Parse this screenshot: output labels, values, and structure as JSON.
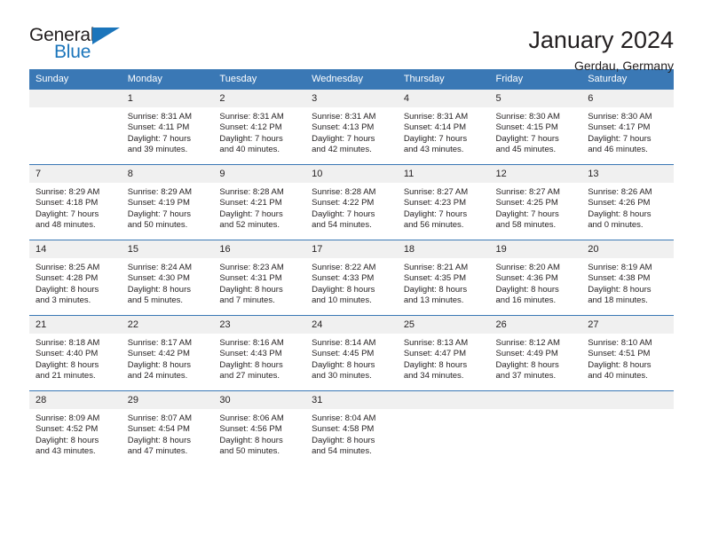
{
  "logo": {
    "word_one": "General",
    "word_two": "Blue",
    "accent_color": "#1b75bb",
    "triangle_icon": "triangle-icon"
  },
  "header": {
    "title": "January 2024",
    "subtitle": "Gerdau, Germany"
  },
  "calendar": {
    "header_bg": "#3a78b5",
    "daynum_bg": "#f0f0f0",
    "weekdays": [
      "Sunday",
      "Monday",
      "Tuesday",
      "Wednesday",
      "Thursday",
      "Friday",
      "Saturday"
    ],
    "weeks": [
      [
        {
          "day": "",
          "sunrise": "",
          "sunset": "",
          "daylight1": "",
          "daylight2": ""
        },
        {
          "day": "1",
          "sunrise": "Sunrise: 8:31 AM",
          "sunset": "Sunset: 4:11 PM",
          "daylight1": "Daylight: 7 hours",
          "daylight2": "and 39 minutes."
        },
        {
          "day": "2",
          "sunrise": "Sunrise: 8:31 AM",
          "sunset": "Sunset: 4:12 PM",
          "daylight1": "Daylight: 7 hours",
          "daylight2": "and 40 minutes."
        },
        {
          "day": "3",
          "sunrise": "Sunrise: 8:31 AM",
          "sunset": "Sunset: 4:13 PM",
          "daylight1": "Daylight: 7 hours",
          "daylight2": "and 42 minutes."
        },
        {
          "day": "4",
          "sunrise": "Sunrise: 8:31 AM",
          "sunset": "Sunset: 4:14 PM",
          "daylight1": "Daylight: 7 hours",
          "daylight2": "and 43 minutes."
        },
        {
          "day": "5",
          "sunrise": "Sunrise: 8:30 AM",
          "sunset": "Sunset: 4:15 PM",
          "daylight1": "Daylight: 7 hours",
          "daylight2": "and 45 minutes."
        },
        {
          "day": "6",
          "sunrise": "Sunrise: 8:30 AM",
          "sunset": "Sunset: 4:17 PM",
          "daylight1": "Daylight: 7 hours",
          "daylight2": "and 46 minutes."
        }
      ],
      [
        {
          "day": "7",
          "sunrise": "Sunrise: 8:29 AM",
          "sunset": "Sunset: 4:18 PM",
          "daylight1": "Daylight: 7 hours",
          "daylight2": "and 48 minutes."
        },
        {
          "day": "8",
          "sunrise": "Sunrise: 8:29 AM",
          "sunset": "Sunset: 4:19 PM",
          "daylight1": "Daylight: 7 hours",
          "daylight2": "and 50 minutes."
        },
        {
          "day": "9",
          "sunrise": "Sunrise: 8:28 AM",
          "sunset": "Sunset: 4:21 PM",
          "daylight1": "Daylight: 7 hours",
          "daylight2": "and 52 minutes."
        },
        {
          "day": "10",
          "sunrise": "Sunrise: 8:28 AM",
          "sunset": "Sunset: 4:22 PM",
          "daylight1": "Daylight: 7 hours",
          "daylight2": "and 54 minutes."
        },
        {
          "day": "11",
          "sunrise": "Sunrise: 8:27 AM",
          "sunset": "Sunset: 4:23 PM",
          "daylight1": "Daylight: 7 hours",
          "daylight2": "and 56 minutes."
        },
        {
          "day": "12",
          "sunrise": "Sunrise: 8:27 AM",
          "sunset": "Sunset: 4:25 PM",
          "daylight1": "Daylight: 7 hours",
          "daylight2": "and 58 minutes."
        },
        {
          "day": "13",
          "sunrise": "Sunrise: 8:26 AM",
          "sunset": "Sunset: 4:26 PM",
          "daylight1": "Daylight: 8 hours",
          "daylight2": "and 0 minutes."
        }
      ],
      [
        {
          "day": "14",
          "sunrise": "Sunrise: 8:25 AM",
          "sunset": "Sunset: 4:28 PM",
          "daylight1": "Daylight: 8 hours",
          "daylight2": "and 3 minutes."
        },
        {
          "day": "15",
          "sunrise": "Sunrise: 8:24 AM",
          "sunset": "Sunset: 4:30 PM",
          "daylight1": "Daylight: 8 hours",
          "daylight2": "and 5 minutes."
        },
        {
          "day": "16",
          "sunrise": "Sunrise: 8:23 AM",
          "sunset": "Sunset: 4:31 PM",
          "daylight1": "Daylight: 8 hours",
          "daylight2": "and 7 minutes."
        },
        {
          "day": "17",
          "sunrise": "Sunrise: 8:22 AM",
          "sunset": "Sunset: 4:33 PM",
          "daylight1": "Daylight: 8 hours",
          "daylight2": "and 10 minutes."
        },
        {
          "day": "18",
          "sunrise": "Sunrise: 8:21 AM",
          "sunset": "Sunset: 4:35 PM",
          "daylight1": "Daylight: 8 hours",
          "daylight2": "and 13 minutes."
        },
        {
          "day": "19",
          "sunrise": "Sunrise: 8:20 AM",
          "sunset": "Sunset: 4:36 PM",
          "daylight1": "Daylight: 8 hours",
          "daylight2": "and 16 minutes."
        },
        {
          "day": "20",
          "sunrise": "Sunrise: 8:19 AM",
          "sunset": "Sunset: 4:38 PM",
          "daylight1": "Daylight: 8 hours",
          "daylight2": "and 18 minutes."
        }
      ],
      [
        {
          "day": "21",
          "sunrise": "Sunrise: 8:18 AM",
          "sunset": "Sunset: 4:40 PM",
          "daylight1": "Daylight: 8 hours",
          "daylight2": "and 21 minutes."
        },
        {
          "day": "22",
          "sunrise": "Sunrise: 8:17 AM",
          "sunset": "Sunset: 4:42 PM",
          "daylight1": "Daylight: 8 hours",
          "daylight2": "and 24 minutes."
        },
        {
          "day": "23",
          "sunrise": "Sunrise: 8:16 AM",
          "sunset": "Sunset: 4:43 PM",
          "daylight1": "Daylight: 8 hours",
          "daylight2": "and 27 minutes."
        },
        {
          "day": "24",
          "sunrise": "Sunrise: 8:14 AM",
          "sunset": "Sunset: 4:45 PM",
          "daylight1": "Daylight: 8 hours",
          "daylight2": "and 30 minutes."
        },
        {
          "day": "25",
          "sunrise": "Sunrise: 8:13 AM",
          "sunset": "Sunset: 4:47 PM",
          "daylight1": "Daylight: 8 hours",
          "daylight2": "and 34 minutes."
        },
        {
          "day": "26",
          "sunrise": "Sunrise: 8:12 AM",
          "sunset": "Sunset: 4:49 PM",
          "daylight1": "Daylight: 8 hours",
          "daylight2": "and 37 minutes."
        },
        {
          "day": "27",
          "sunrise": "Sunrise: 8:10 AM",
          "sunset": "Sunset: 4:51 PM",
          "daylight1": "Daylight: 8 hours",
          "daylight2": "and 40 minutes."
        }
      ],
      [
        {
          "day": "28",
          "sunrise": "Sunrise: 8:09 AM",
          "sunset": "Sunset: 4:52 PM",
          "daylight1": "Daylight: 8 hours",
          "daylight2": "and 43 minutes."
        },
        {
          "day": "29",
          "sunrise": "Sunrise: 8:07 AM",
          "sunset": "Sunset: 4:54 PM",
          "daylight1": "Daylight: 8 hours",
          "daylight2": "and 47 minutes."
        },
        {
          "day": "30",
          "sunrise": "Sunrise: 8:06 AM",
          "sunset": "Sunset: 4:56 PM",
          "daylight1": "Daylight: 8 hours",
          "daylight2": "and 50 minutes."
        },
        {
          "day": "31",
          "sunrise": "Sunrise: 8:04 AM",
          "sunset": "Sunset: 4:58 PM",
          "daylight1": "Daylight: 8 hours",
          "daylight2": "and 54 minutes."
        },
        {
          "day": "",
          "sunrise": "",
          "sunset": "",
          "daylight1": "",
          "daylight2": ""
        },
        {
          "day": "",
          "sunrise": "",
          "sunset": "",
          "daylight1": "",
          "daylight2": ""
        },
        {
          "day": "",
          "sunrise": "",
          "sunset": "",
          "daylight1": "",
          "daylight2": ""
        }
      ]
    ]
  }
}
